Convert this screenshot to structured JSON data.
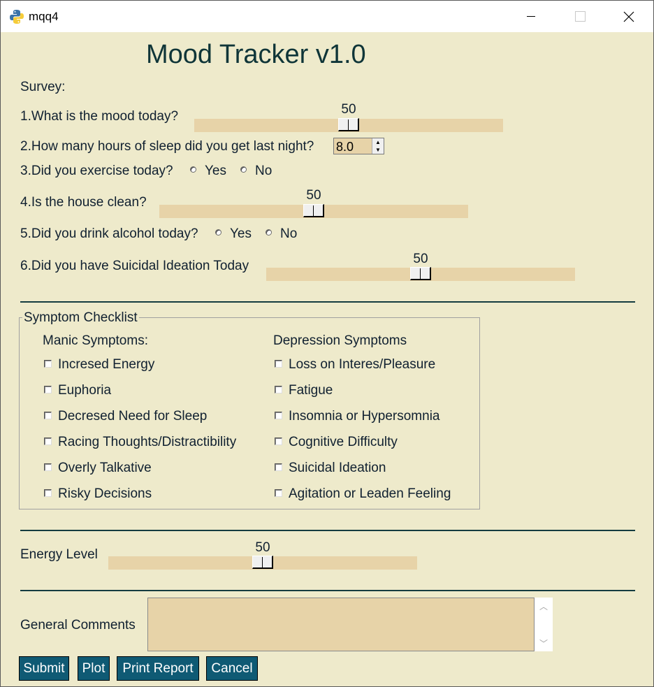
{
  "window": {
    "title": "mqq4"
  },
  "app": {
    "title": "Mood Tracker v1.0"
  },
  "survey": {
    "heading": "Survey:",
    "q1": {
      "label": "1.What is the mood today?",
      "value": 50
    },
    "q2": {
      "label": "2.How many hours of sleep did you get last night?",
      "value": "8.0"
    },
    "q3": {
      "label": "3.Did you exercise today?",
      "yes": "Yes",
      "no": "No"
    },
    "q4": {
      "label": "4.Is the house clean?",
      "value": 50
    },
    "q5": {
      "label": "5.Did you drink alcohol today?",
      "yes": "Yes",
      "no": "No"
    },
    "q6": {
      "label": "6.Did you have Suicidal Ideation Today",
      "value": 50
    }
  },
  "checklist": {
    "title": "Symptom Checklist",
    "manic": {
      "heading": "Manic Symptoms:",
      "items": [
        "Incresed Energy",
        "Euphoria",
        "Decresed Need for Sleep",
        "Racing Thoughts/Distractibility",
        "Overly Talkative",
        "Risky Decisions"
      ]
    },
    "depression": {
      "heading": "Depression Symptoms",
      "items": [
        "Loss on Interes/Pleasure",
        "Fatigue",
        "Insomnia or Hypersomnia",
        "Cognitive Difficulty",
        "Suicidal Ideation",
        "Agitation or Leaden Feeling"
      ]
    }
  },
  "energy": {
    "label": "Energy Level",
    "value": 50
  },
  "comments": {
    "label": "General Comments",
    "value": ""
  },
  "buttons": {
    "submit": "Submit",
    "plot": "Plot",
    "print": "Print Report",
    "cancel": "Cancel"
  },
  "icons": {
    "app": "python-icon",
    "minimize": "minimize-icon",
    "maximize": "maximize-icon",
    "close": "close-icon"
  },
  "colors": {
    "background": "#eeeacb",
    "trough": "#e7d3a8",
    "button": "#0f5a74",
    "separator": "#143c40"
  }
}
